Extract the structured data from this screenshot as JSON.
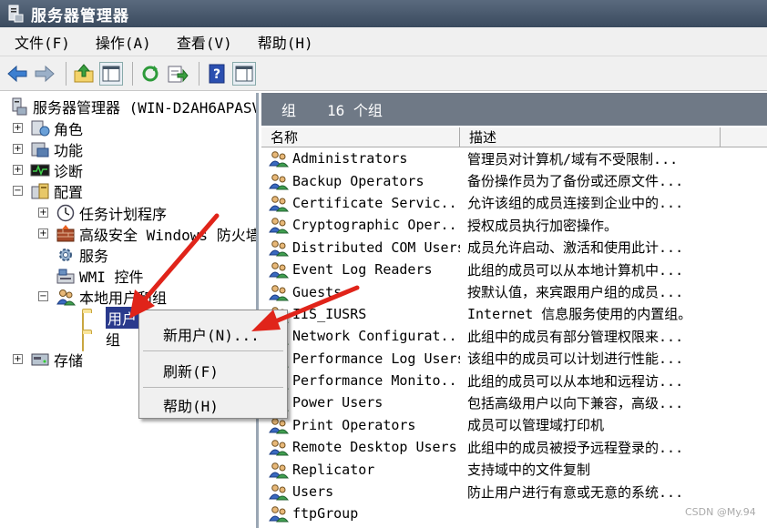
{
  "window": {
    "title": "服务器管理器"
  },
  "menubar": [
    {
      "label": "文件(F)"
    },
    {
      "label": "操作(A)"
    },
    {
      "label": "查看(V)"
    },
    {
      "label": "帮助(H)"
    }
  ],
  "toolbar": {
    "icons": [
      "back-arrow-icon",
      "forward-arrow-icon",
      "up-folder-icon",
      "show-hide-tree-icon",
      "refresh-icon",
      "export-list-icon",
      "help-icon",
      "action-pane-icon"
    ]
  },
  "tree": {
    "root": "服务器管理器 (WIN-D2AH6APASV",
    "nodes": [
      {
        "label": "角色",
        "expander": "+"
      },
      {
        "label": "功能",
        "expander": "+"
      },
      {
        "label": "诊断",
        "expander": "+"
      },
      {
        "label": "配置",
        "expander": "−"
      },
      {
        "label": "任务计划程序",
        "expander": "+"
      },
      {
        "label": "高级安全 Windows 防火墙",
        "expander": "+"
      },
      {
        "label": "服务",
        "expander": ""
      },
      {
        "label": "WMI 控件",
        "expander": ""
      },
      {
        "label": "本地用户和组",
        "expander": "−"
      },
      {
        "label": "用户",
        "expander": ""
      },
      {
        "label": "组",
        "expander": ""
      },
      {
        "label": "存储",
        "expander": "+"
      }
    ]
  },
  "group_panel": {
    "title": "组",
    "count_text": "16 个组",
    "columns": [
      "名称",
      "描述"
    ],
    "rows": [
      {
        "name": "Administrators",
        "desc": "管理员对计算机/域有不受限制..."
      },
      {
        "name": "Backup Operators",
        "desc": "备份操作员为了备份或还原文件..."
      },
      {
        "name": "Certificate Servic...",
        "desc": "允许该组的成员连接到企业中的..."
      },
      {
        "name": "Cryptographic Oper...",
        "desc": "授权成员执行加密操作。"
      },
      {
        "name": "Distributed COM Users",
        "desc": "成员允许启动、激活和使用此计..."
      },
      {
        "name": "Event Log Readers",
        "desc": "此组的成员可以从本地计算机中..."
      },
      {
        "name": "Guests",
        "desc": "按默认值，来宾跟用户组的成员..."
      },
      {
        "name": "IIS_IUSRS",
        "desc": "Internet 信息服务使用的内置组。"
      },
      {
        "name": "Network Configurat...",
        "desc": "此组中的成员有部分管理权限来..."
      },
      {
        "name": "Performance Log Users",
        "desc": "该组中的成员可以计划进行性能..."
      },
      {
        "name": "Performance Monito...",
        "desc": "此组的成员可以从本地和远程访..."
      },
      {
        "name": "Power Users",
        "desc": "包括高级用户以向下兼容，高级..."
      },
      {
        "name": "Print Operators",
        "desc": "成员可以管理域打印机"
      },
      {
        "name": "Remote Desktop Users",
        "desc": "此组中的成员被授予远程登录的..."
      },
      {
        "name": "Replicator",
        "desc": "支持域中的文件复制"
      },
      {
        "name": "Users",
        "desc": "防止用户进行有意或无意的系统..."
      },
      {
        "name": "ftpGroup",
        "desc": ""
      }
    ]
  },
  "context_menu": {
    "items": [
      "新用户(N)...",
      "刷新(F)",
      "帮助(H)"
    ]
  },
  "watermark": "CSDN @My.94",
  "colors": {
    "title_bar": "#3a4a5e",
    "header_band": "#6f7986",
    "selection": "#2a3a8c",
    "arrow": "#e0241a"
  }
}
